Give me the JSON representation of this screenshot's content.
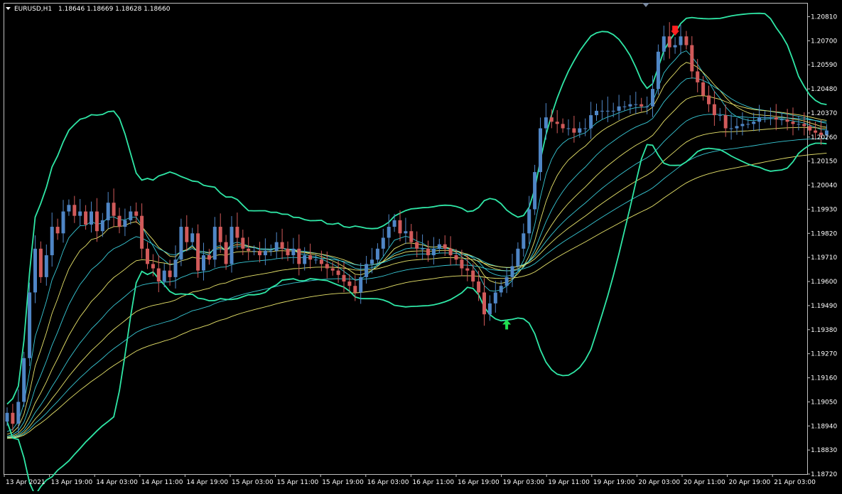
{
  "header": {
    "symbol": "EURUSD,H1",
    "ohlc": "1.18646 1.18669 1.18628 1.18660"
  },
  "colors": {
    "background": "#000000",
    "frame": "#c0c0c0",
    "bull": "#4f86c6",
    "bear": "#d15a5a",
    "envelope": "#2fe7a6",
    "ma_cyan": "#38c9d6",
    "ma_yellow": "#e9e56b",
    "sell_arrow": "#ff2020",
    "buy_arrow": "#20e050"
  },
  "chart_data": {
    "type": "candlestick",
    "symbol": "EURUSD",
    "timeframe": "H1",
    "ylim": [
      1.1872,
      1.2087
    ],
    "y_ticks": [
      "1.20810",
      "1.20700",
      "1.20590",
      "1.20480",
      "1.20370",
      "1.20260",
      "1.20150",
      "1.20040",
      "1.19930",
      "1.19820",
      "1.19710",
      "1.19600",
      "1.19490",
      "1.19380",
      "1.19270",
      "1.19160",
      "1.19050",
      "1.18940",
      "1.18830",
      "1.18720"
    ],
    "x_ticks": [
      "13 Apr 2021",
      "13 Apr 19:00",
      "14 Apr 03:00",
      "14 Apr 11:00",
      "14 Apr 19:00",
      "15 Apr 03:00",
      "15 Apr 11:00",
      "15 Apr 19:00",
      "16 Apr 03:00",
      "16 Apr 11:00",
      "16 Apr 19:00",
      "19 Apr 03:00",
      "19 Apr 11:00",
      "19 Apr 19:00",
      "20 Apr 03:00",
      "20 Apr 11:00",
      "20 Apr 19:00",
      "21 Apr 03:00"
    ],
    "markers": [
      {
        "type": "sell-arrow",
        "bar": 119,
        "price": 1.2073
      },
      {
        "type": "buy-arrow",
        "bar": 89,
        "price": 1.1942
      }
    ],
    "closes": [
      1.19,
      1.1895,
      1.1905,
      1.1925,
      1.1955,
      1.1975,
      1.1962,
      1.1972,
      1.1985,
      1.1982,
      1.1992,
      1.1995,
      1.199,
      1.1992,
      1.1986,
      1.1992,
      1.1983,
      1.1988,
      1.1996,
      1.199,
      1.1985,
      1.1988,
      1.1992,
      1.199,
      1.1975,
      1.1968,
      1.1966,
      1.196,
      1.1965,
      1.1962,
      1.197,
      1.1985,
      1.1978,
      1.1982,
      1.1965,
      1.1972,
      1.197,
      1.1985,
      1.1978,
      1.1968,
      1.1985,
      1.198,
      1.1975,
      1.1974,
      1.1974,
      1.1972,
      1.1974,
      1.1974,
      1.1978,
      1.1975,
      1.1972,
      1.1975,
      1.1968,
      1.1972,
      1.197,
      1.197,
      1.1968,
      1.1966,
      1.1965,
      1.1963,
      1.196,
      1.1958,
      1.1955,
      1.1962,
      1.1968,
      1.197,
      1.1975,
      1.198,
      1.1985,
      1.1988,
      1.1982,
      1.1983,
      1.1978,
      1.1975,
      1.1975,
      1.1972,
      1.1975,
      1.1977,
      1.1975,
      1.1972,
      1.197,
      1.1966,
      1.1965,
      1.196,
      1.1955,
      1.1945,
      1.195,
      1.1955,
      1.1958,
      1.1962,
      1.1967,
      1.1975,
      1.1982,
      1.1993,
      1.201,
      1.203,
      1.2035,
      1.2033,
      1.2032,
      1.203,
      1.203,
      1.2028,
      1.203,
      1.203,
      1.2036,
      1.2038,
      1.2038,
      1.2038,
      1.2038,
      1.204,
      1.204,
      1.2041,
      1.2041,
      1.204,
      1.204,
      1.2048,
      1.2065,
      1.2072,
      1.2067,
      1.2068,
      1.2072,
      1.2068,
      1.2056,
      1.2051,
      1.2045,
      1.2041,
      1.2036,
      1.2036,
      1.203,
      1.203,
      1.2031,
      1.2032,
      1.2032,
      1.2033,
      1.2035,
      1.2035,
      1.2035,
      1.2034,
      1.2034,
      1.2033,
      1.2032,
      1.2032,
      1.2031,
      1.2029,
      1.2028,
      1.2027,
      1.2029
    ]
  }
}
